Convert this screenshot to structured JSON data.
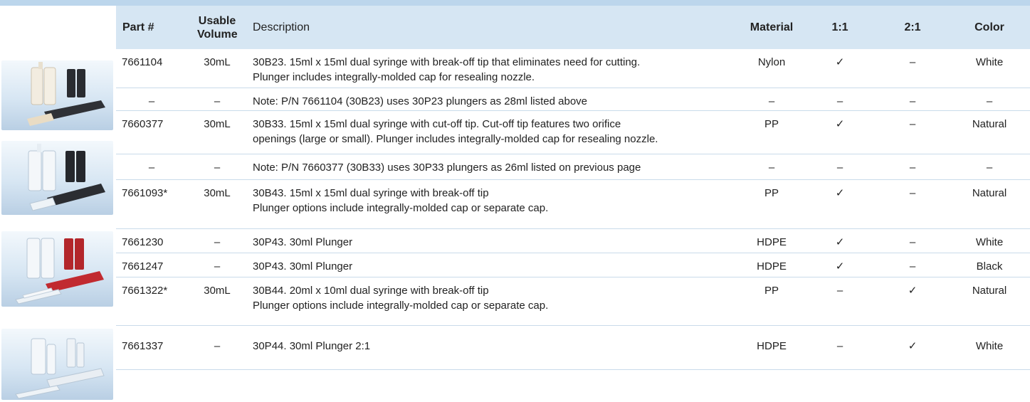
{
  "columns": {
    "part": "Part #",
    "usable_volume": "Usable Volume",
    "description": "Description",
    "material": "Material",
    "ratio_1_1": "1:1",
    "ratio_2_1": "2:1",
    "color": "Color"
  },
  "rows": [
    {
      "part": "7661104",
      "volume": "30mL",
      "desc1": "30B23. 15ml x 15ml dual syringe with break-off tip that eliminates need for cutting.",
      "desc2": "Plunger includes integrally-molded cap for resealing nozzle.",
      "material": "Nylon",
      "r11": "✓",
      "r21": "–",
      "color": "White"
    },
    {
      "part": "–",
      "volume": "–",
      "desc1": "Note: P/N 7661104 (30B23) uses 30P23 plungers as 28ml listed above",
      "desc2": "",
      "material": "–",
      "r11": "–",
      "r21": "–",
      "color": "–"
    },
    {
      "part": "7660377",
      "volume": "30mL",
      "desc1": "30B33. 15ml x 15ml dual syringe with cut-off tip. Cut-off tip features two orifice",
      "desc2": "openings (large or small). Plunger includes integrally-molded cap for resealing nozzle.",
      "material": "PP",
      "r11": "✓",
      "r21": "–",
      "color": "Natural"
    },
    {
      "part": "–",
      "volume": "–",
      "desc1": "Note: P/N 7660377 (30B33) uses 30P33 plungers as 26ml listed on previous page",
      "desc2": "",
      "material": "–",
      "r11": "–",
      "r21": "–",
      "color": "–"
    },
    {
      "part": "7661093*",
      "volume": "30mL",
      "desc1": "30B43. 15ml x 15ml dual syringe with break-off tip",
      "desc2": "Plunger options include integrally-molded cap or separate cap.",
      "material": "PP",
      "r11": "✓",
      "r21": "–",
      "color": "Natural"
    },
    {
      "part": "7661230",
      "volume": "–",
      "desc1": "30P43. 30ml Plunger",
      "desc2": "",
      "material": "HDPE",
      "r11": "✓",
      "r21": "–",
      "color": "White"
    },
    {
      "part": "7661247",
      "volume": "–",
      "desc1": "30P43. 30ml Plunger",
      "desc2": "",
      "material": "HDPE",
      "r11": "✓",
      "r21": "–",
      "color": "Black"
    },
    {
      "part": "7661322*",
      "volume": "30mL",
      "desc1": "30B44. 20ml x 10ml dual syringe with break-off tip",
      "desc2": "Plunger options include integrally-molded cap or separate cap.",
      "material": "PP",
      "r11": "–",
      "r21": "✓",
      "color": "Natural"
    },
    {
      "part": "7661337",
      "volume": "–",
      "desc1": "30P44. 30ml Plunger 2:1",
      "desc2": "",
      "material": "HDPE",
      "r11": "–",
      "r21": "✓",
      "color": "White"
    }
  ],
  "colors": {
    "header_bg": "#d6e6f3",
    "top_bar": "#bcd6ec",
    "row_divider": "#c9dbea"
  }
}
